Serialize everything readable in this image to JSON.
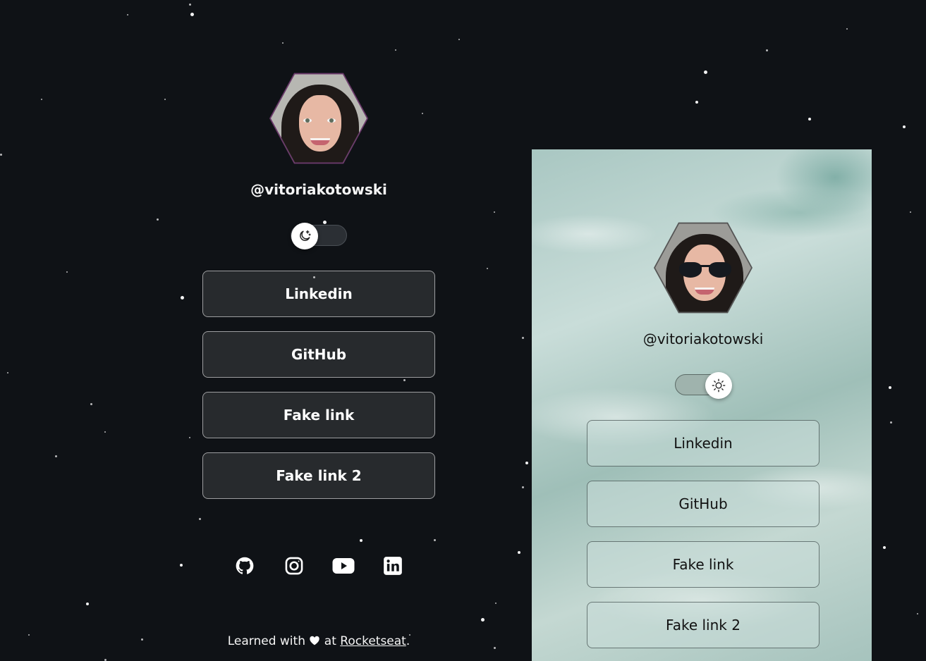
{
  "dark_profile": {
    "username": "@vitoriakotowski",
    "links": [
      "Linkedin",
      "GitHub",
      "Fake link",
      "Fake link 2"
    ],
    "social_icons": [
      "github-icon",
      "instagram-icon",
      "youtube-icon",
      "linkedin-icon"
    ],
    "footer": {
      "prefix": "Learned with",
      "middle": "at",
      "link": "Rocketseat",
      "suffix": "."
    }
  },
  "light_profile": {
    "username": "@vitoriakotowski",
    "links": [
      "Linkedin",
      "GitHub",
      "Fake link",
      "Fake link 2"
    ]
  },
  "colors": {
    "dark_background": "#0f1216",
    "dark_button": "#262a2f",
    "light_background": "#b8d2cd",
    "avatar_border": "#6b3a6b"
  }
}
